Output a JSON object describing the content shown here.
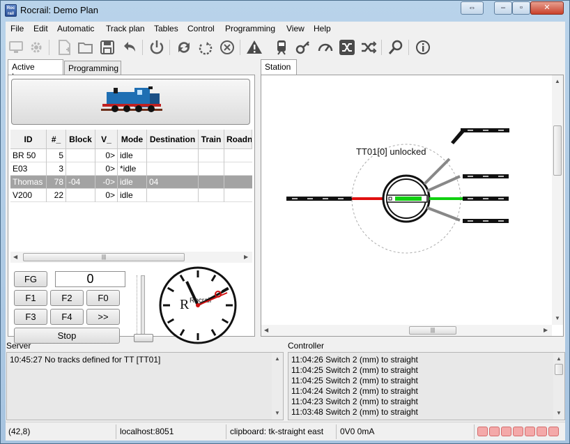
{
  "window": {
    "title": "Rocrail: Demo Plan",
    "app_icon_text": "Roc rail",
    "controls": [
      "⇔",
      "–",
      "▫",
      "✕"
    ]
  },
  "menu": [
    "File",
    "Edit",
    "Automatic",
    "Track plan",
    "Tables",
    "Control",
    "Programming",
    "View",
    "Help"
  ],
  "toolbar": {
    "icons": [
      "server-icon",
      "settings-gear-icon",
      "new-file-icon",
      "open-folder-icon",
      "save-icon",
      "undo-icon",
      "power-icon",
      "sync-icon",
      "rotate-icon",
      "cancel-icon",
      "warning-icon",
      "train-icon",
      "loco-key-icon",
      "gauge-icon",
      "shuffle-box-icon",
      "shuffle-icon",
      "zoom-icon",
      "info-icon"
    ]
  },
  "left_tabs": [
    "Active Locos",
    "Programming"
  ],
  "right_tabs": [
    "Station"
  ],
  "loco_table": {
    "columns": [
      "ID",
      "#_",
      "Block",
      "V_",
      "Mode",
      "Destination",
      "Train",
      "Roadn"
    ],
    "rows": [
      {
        "id": "BR 50",
        "num": "5",
        "block": "",
        "v": "0>",
        "mode": "idle",
        "dest": "",
        "train": ""
      },
      {
        "id": "E03",
        "num": "3",
        "block": "",
        "v": "0>",
        "mode": "*idle",
        "dest": "",
        "train": ""
      },
      {
        "id": "Thomas",
        "num": "78",
        "block": "-04",
        "v": "-0>",
        "mode": "idle",
        "dest": "04",
        "train": ""
      },
      {
        "id": "V200",
        "num": "22",
        "block": "",
        "v": "0>",
        "mode": "idle",
        "dest": "",
        "train": ""
      }
    ],
    "selected_row": 2
  },
  "controls": {
    "fg": "FG",
    "speed_value": "0",
    "f1": "F1",
    "f2": "F2",
    "f0": "F0",
    "f3": "F3",
    "f4": "F4",
    "more": ">>",
    "stop": "Stop",
    "clock_logo": "Rocrail"
  },
  "track": {
    "turntable_label": "TT01[0] unlocked"
  },
  "server": {
    "label": "Server",
    "lines": [
      "10:45:27 No tracks defined for TT [TT01]"
    ]
  },
  "controller": {
    "label": "Controller",
    "lines": [
      "11:04:26 Switch 2 (mm) to straight",
      "11:04:25 Switch 2 (mm) to straight",
      "11:04:25 Switch 2 (mm) to straight",
      "11:04:24 Switch 2 (mm) to straight",
      "11:04:23 Switch 2 (mm) to straight",
      "11:03:48 Switch 2 (mm) to straight"
    ]
  },
  "status": {
    "coords": "(42,8)",
    "host": "localhost:8051",
    "clipboard": "clipboard: tk-straight east",
    "power": "0V0 0mA"
  },
  "colors": {
    "selected_row": "#a3a3a3",
    "track_red": "#e01010",
    "track_green": "#10d010",
    "led_off": "#f4a9a9"
  }
}
